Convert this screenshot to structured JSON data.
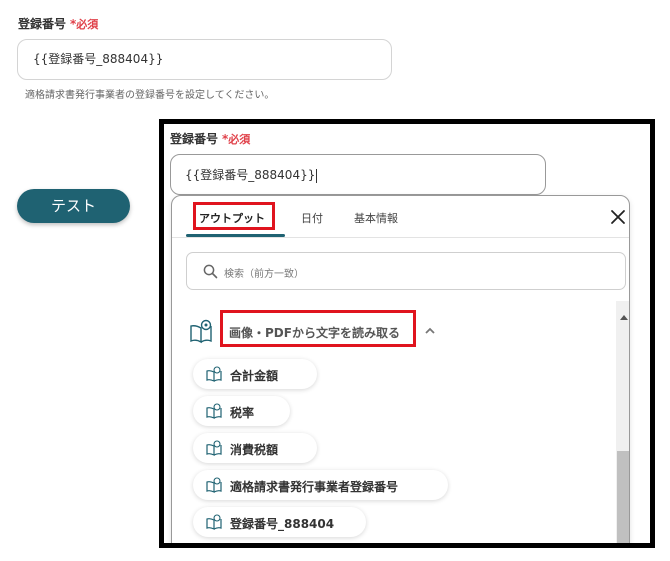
{
  "field": {
    "label": "登録番号",
    "required_mark": "*",
    "required_text": "必須",
    "value": "{{登録番号_888404}}",
    "help": "適格請求書発行事業者の登録番号を設定してください。"
  },
  "test_button": {
    "label": "テスト"
  },
  "zoom_panel": {
    "label": "登録番号",
    "required_mark": "*",
    "required_text": "必須",
    "value": "{{登録番号_888404}}",
    "tabs": [
      {
        "label": "アウトプット",
        "active": true
      },
      {
        "label": "日付",
        "active": false
      },
      {
        "label": "基本情報",
        "active": false
      }
    ],
    "search": {
      "placeholder": "検索（前方一致）"
    },
    "group": {
      "title": "画像・PDFから文字を読み取る",
      "expanded": true
    },
    "items": [
      {
        "label": "合計金額"
      },
      {
        "label": "税率"
      },
      {
        "label": "消費税額"
      },
      {
        "label": "適格請求書発行事業者登録番号"
      },
      {
        "label": "登録番号_888404"
      }
    ]
  },
  "colors": {
    "accent": "#1f6272",
    "required": "#e0414a",
    "highlight": "#e0141e",
    "icon": "#1f6272"
  },
  "icons": {
    "close": "close-icon",
    "search": "search-icon",
    "group": "book-icon",
    "item": "book-icon",
    "chevron": "chevron-up-icon"
  }
}
